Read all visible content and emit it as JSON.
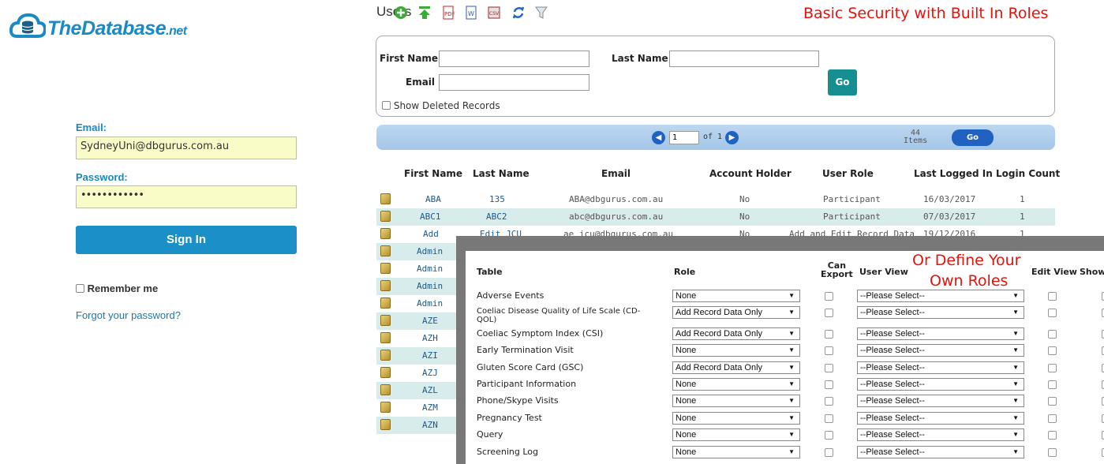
{
  "logo": {
    "main": "TheDatabase",
    "suffix": ".net"
  },
  "login": {
    "email_label": "Email:",
    "email_value": "SydneyUni@dbgurus.com.au",
    "password_label": "Password:",
    "password_value": "••••••••••••",
    "signin_label": "Sign In",
    "remember_label": "Remember me",
    "forgot_label": "Forgot your password?"
  },
  "header": {
    "title": "Users",
    "note": "Basic Security with Built In Roles"
  },
  "search": {
    "first_name_label": "First Name",
    "last_name_label": "Last Name",
    "email_label": "Email",
    "go_label": "Go",
    "show_deleted_label": "Show Deleted Records"
  },
  "toolbar": {
    "page_value": "1",
    "of_text": "of 1",
    "items_count": "44",
    "items_label": "Items",
    "go_label": "Go"
  },
  "table": {
    "headers": [
      "First Name",
      "Last Name",
      "Email",
      "Account Holder",
      "User Role",
      "Last Logged In",
      "Login Count"
    ],
    "rows": [
      [
        "ABA",
        "135",
        "ABA@dbgurus.com.au",
        "No",
        "Participant",
        "16/03/2017",
        "1"
      ],
      [
        "ABC1",
        "ABC2",
        "abc@dbgurus.com.au",
        "No",
        "Participant",
        "07/03/2017",
        "1"
      ],
      [
        "Add",
        "Edit JCU",
        "ae_jcu@dbgurus.com.au",
        "No",
        "Add and Edit Record Data",
        "19/12/2016",
        "1"
      ],
      [
        "Admin"
      ],
      [
        "Admin"
      ],
      [
        "Admin"
      ],
      [
        "Admin"
      ],
      [
        "AZE"
      ],
      [
        "AZH"
      ],
      [
        "AZI"
      ],
      [
        "AZJ"
      ],
      [
        "AZL"
      ],
      [
        "AZM"
      ],
      [
        "AZN"
      ]
    ]
  },
  "roles_overlay": {
    "note_line1": "Or Define Your",
    "note_line2": "Own Roles",
    "headers": {
      "table": "Table",
      "role": "Role",
      "can_export_1": "Can",
      "can_export_2": "Export",
      "user_view": "User View",
      "edit_view": "Edit View",
      "show": "Show"
    },
    "rows": [
      {
        "table": "Adverse Events",
        "role": "None",
        "view": "--Please Select--"
      },
      {
        "table": "Coeliac Disease Quality of Life Scale (CD-QOL)",
        "table_l1": "Coeliac Disease Quality of Life Scale (CD-",
        "table_l2": "QOL)",
        "role": "Add Record Data Only",
        "view": "--Please Select--"
      },
      {
        "table": "Coeliac Symptom Index (CSI)",
        "role": "Add Record Data Only",
        "view": "--Please Select--"
      },
      {
        "table": "Early Termination Visit",
        "role": "None",
        "view": "--Please Select--"
      },
      {
        "table": "Gluten Score Card (GSC)",
        "role": "Add Record Data Only",
        "view": "--Please Select--"
      },
      {
        "table": "Participant Information",
        "role": "None",
        "view": "--Please Select--"
      },
      {
        "table": "Phone/Skype Visits",
        "role": "None",
        "view": "--Please Select--"
      },
      {
        "table": "Pregnancy Test",
        "role": "None",
        "view": "--Please Select--"
      },
      {
        "table": "Query",
        "role": "None",
        "view": "--Please Select--"
      },
      {
        "table": "Screening Log",
        "role": "None",
        "view": "--Please Select--"
      }
    ]
  },
  "colors": {
    "brand": "#1a8ac6",
    "accent_red": "#e8120c",
    "signin": "#1b90c8",
    "go_teal": "#178e92",
    "row_alt": "#d9ecec"
  }
}
